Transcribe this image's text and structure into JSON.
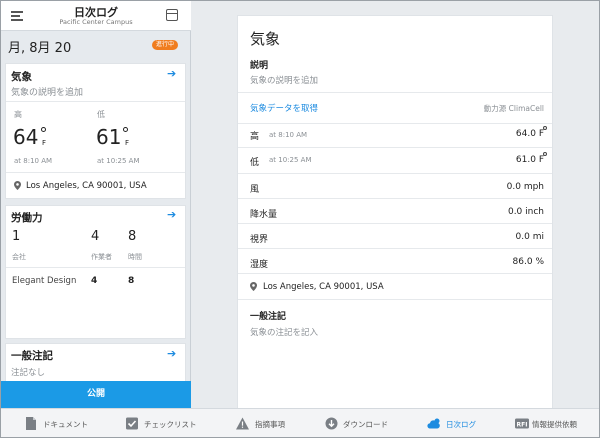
{
  "header": {
    "title": "日次ログ",
    "subtitle": "Pacific Center Campus"
  },
  "date": {
    "label": "月, 8月 20",
    "badge": "進行中"
  },
  "weather_card": {
    "title": "気象",
    "description": "気象の説明を追加",
    "high_label": "高",
    "high_temp": "64",
    "high_unit": "F",
    "high_time": "at 8:10 AM",
    "low_label": "低",
    "low_temp": "61",
    "low_unit": "F",
    "low_time": "at 10:25 AM",
    "location": "Los Angeles, CA 90001, USA"
  },
  "labor_card": {
    "title": "労働力",
    "totals": [
      {
        "value": "1",
        "label": "会社"
      },
      {
        "value": "4",
        "label": "作業者"
      },
      {
        "value": "8",
        "label": "時間"
      }
    ],
    "rows": [
      {
        "company": "Elegant Design",
        "workers": "4",
        "hours": "8"
      }
    ]
  },
  "notes_card": {
    "title": "一般注記",
    "text": "注記なし"
  },
  "publish_label": "公開",
  "panel": {
    "title": "気象",
    "desc_heading": "説明",
    "desc_placeholder": "気象の説明を追加",
    "fetch_link": "気象データを取得",
    "powered_by": "動力源 ClimaCell",
    "high": {
      "label": "高",
      "time": "at 8:10 AM",
      "value": "64.0 F"
    },
    "low": {
      "label": "低",
      "time": "at 10:25 AM",
      "value": "61.0 F"
    },
    "rows": [
      {
        "label": "風",
        "value": "0.0 mph"
      },
      {
        "label": "降水量",
        "value": "0.0 inch"
      },
      {
        "label": "視界",
        "value": "0.0 mi"
      },
      {
        "label": "湿度",
        "value": "86.0 %"
      }
    ],
    "location": "Los Angeles, CA 90001, USA",
    "notes_heading": "一般注記",
    "notes_placeholder": "気象の注記を記入"
  },
  "tabs": [
    {
      "label": "ドキュメント",
      "icon": "document-icon"
    },
    {
      "label": "チェックリスト",
      "icon": "checklist-icon"
    },
    {
      "label": "指摘事項",
      "icon": "warning-icon"
    },
    {
      "label": "ダウンロード",
      "icon": "download-icon"
    },
    {
      "label": "日次ログ",
      "icon": "weather-icon",
      "active": true
    },
    {
      "label": "情報提供依頼",
      "icon": "rfi-icon"
    }
  ],
  "colors": {
    "accent": "#1c8be0",
    "badge": "#f07d1f",
    "publish": "#1b9ae6"
  }
}
